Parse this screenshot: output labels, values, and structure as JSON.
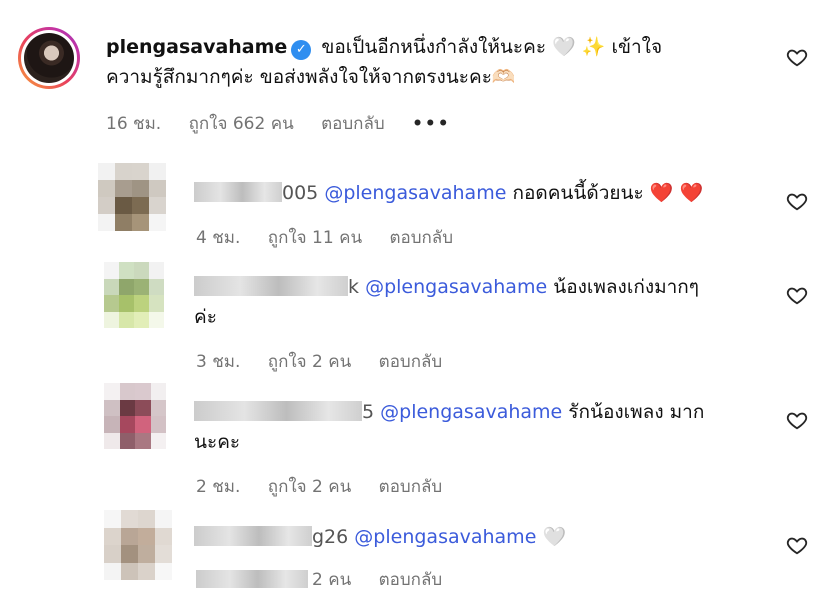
{
  "main_comment": {
    "username": "plengasavahame",
    "text_line1": "ขอเป็นอีกหนึ่งกำลังให้นะคะ",
    "emoji1": "🤍",
    "emoji2": "✨",
    "text_line1_end": "เข้าใจ",
    "text_line2": "ความรู้สึกมากๆค่ะ ขอส่งพลังใจให้จากตรงนะคะ",
    "emoji3": "🫶🏻",
    "time": "16 ชม.",
    "likes": "ถูกใจ 662 คน",
    "reply": "ตอบกลับ",
    "more": "•••"
  },
  "replies": [
    {
      "username_visible": "005",
      "mention": "@plengasavahame",
      "text": "กอดคนนี้ด้วยนะ",
      "emojis": "❤️ ❤️",
      "time": "4 ชม.",
      "likes": "ถูกใจ 11 คน",
      "reply": "ตอบกลับ"
    },
    {
      "username_visible": "k",
      "mention": "@plengasavahame",
      "text": "น้องเพลงเก่งมากๆ",
      "text_line2": "ค่ะ",
      "time": "3 ชม.",
      "likes": "ถูกใจ 2 คน",
      "reply": "ตอบกลับ"
    },
    {
      "username_visible": "5",
      "mention": "@plengasavahame",
      "text": "รักน้องเพลง มาก",
      "text_line2": "นะคะ",
      "time": "2 ชม.",
      "likes": "ถูกใจ 2 คน",
      "reply": "ตอบกลับ"
    },
    {
      "username_visible": "g26",
      "mention": "@plengasavahame",
      "emojis": "🤍",
      "likes_visible": "2 คน",
      "reply": "ตอบกลับ"
    }
  ],
  "colors": {
    "mention": "#3b5bdb",
    "meta": "#737373",
    "verified": "#2f8ef0"
  }
}
